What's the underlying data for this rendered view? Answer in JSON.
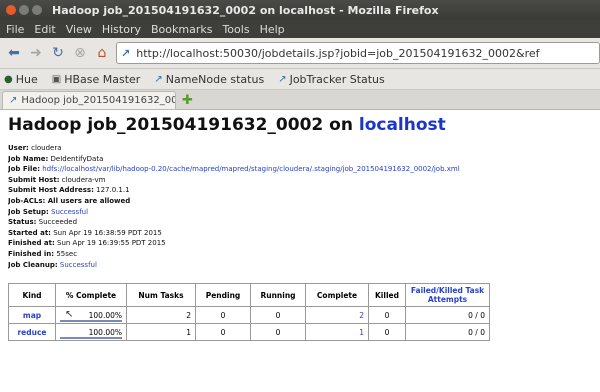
{
  "window": {
    "title": "Hadoop job_201504191632_0002 on localhost - Mozilla Firefox"
  },
  "menu": [
    "File",
    "Edit",
    "View",
    "History",
    "Bookmarks",
    "Tools",
    "Help"
  ],
  "nav": {
    "url": "http://localhost:50030/jobdetails.jsp?jobid=job_201504191632_0002&ref"
  },
  "bookmarks": [
    "Hue",
    "HBase Master",
    "NameNode status",
    "JobTracker Status"
  ],
  "tab": {
    "title": "Hadoop job_201504191632_00..."
  },
  "page": {
    "title_prefix": "Hadoop job_201504191632_0002 on ",
    "title_host": "localhost",
    "info": [
      {
        "label": "User:",
        "value": "cloudera"
      },
      {
        "label": "Job Name:",
        "value": "DeIdentifyData"
      },
      {
        "label": "Job File:",
        "value": "hdfs://localhost/var/lib/hadoop-0.20/cache/mapred/mapred/staging/cloudera/.staging/job_201504191632_0002/job.xml",
        "link": true
      },
      {
        "label": "Submit Host:",
        "value": "cloudera-vm"
      },
      {
        "label": "Submit Host Address:",
        "value": "127.0.1.1"
      },
      {
        "label": "Job-ACLs: All users are allowed",
        "value": ""
      },
      {
        "label": "Job Setup:",
        "value": "Successful",
        "link": true
      },
      {
        "label": "Status:",
        "value": "Succeeded"
      },
      {
        "label": "Started at:",
        "value": "Sun Apr 19 16:38:59 PDT 2015"
      },
      {
        "label": "Finished at:",
        "value": "Sun Apr 19 16:39:55 PDT 2015"
      },
      {
        "label": "Finished in:",
        "value": "55sec"
      },
      {
        "label": "Job Cleanup:",
        "value": "Successful",
        "link": true
      }
    ]
  },
  "table": {
    "headers": [
      "Kind",
      "% Complete",
      "Num Tasks",
      "Pending",
      "Running",
      "Complete",
      "Killed",
      "Failed/Killed Task Attempts"
    ],
    "rows": [
      {
        "kind": "map",
        "pct": "100.00%",
        "pct_fraction": 1.0,
        "num": "2",
        "pending": "0",
        "running": "0",
        "complete": "2",
        "killed": "0",
        "failed": "0 / 0"
      },
      {
        "kind": "reduce",
        "pct": "100.00%",
        "pct_fraction": 1.0,
        "num": "1",
        "pending": "0",
        "running": "0",
        "complete": "1",
        "killed": "0",
        "failed": "0 / 0"
      }
    ]
  },
  "colors": {
    "accent": "#1a35c8",
    "link": "#2842c9",
    "titlebar": "#3e3e3b"
  }
}
